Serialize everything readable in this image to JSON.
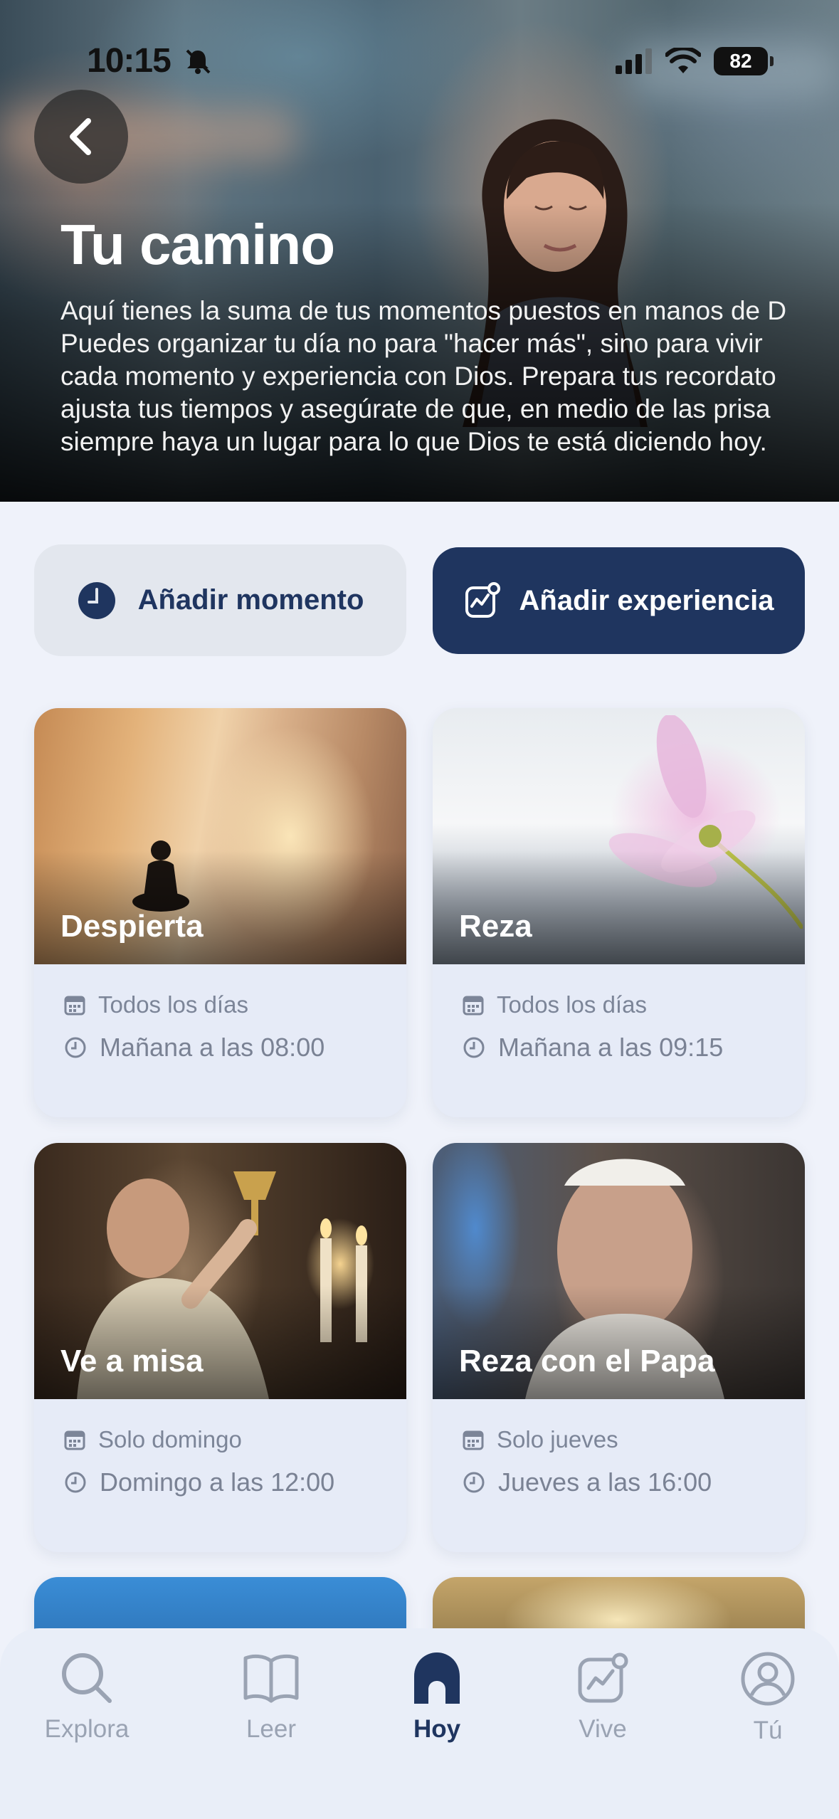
{
  "status_bar": {
    "time": "10:15",
    "battery": "82"
  },
  "hero": {
    "title": "Tu camino",
    "description_lines": [
      "Aquí tienes la suma de tus momentos puestos en manos de D",
      "Puedes organizar tu día no para \"hacer más\", sino para vivir",
      "cada momento y experiencia con Dios. Prepara tus recordato",
      "ajusta tus tiempos y asegúrate de que, en medio de las prisa",
      "siempre haya un lugar para lo que Dios te está diciendo hoy."
    ]
  },
  "actions": {
    "add_moment": "Añadir momento",
    "add_experience": "Añadir experiencia"
  },
  "cards": [
    {
      "title": "Despierta",
      "frequency": "Todos los días",
      "time": "Mañana a las 08:00"
    },
    {
      "title": "Reza",
      "frequency": "Todos los días",
      "time": "Mañana a las 09:15"
    },
    {
      "title": "Ve a misa",
      "frequency": "Solo domingo",
      "time": "Domingo a las 12:00"
    },
    {
      "title": "Reza con el Papa",
      "frequency": "Solo jueves",
      "time": "Jueves a las 16:00"
    }
  ],
  "tabs": [
    {
      "label": "Explora",
      "icon": "search-icon"
    },
    {
      "label": "Leer",
      "icon": "book-icon"
    },
    {
      "label": "Hoy",
      "icon": "home-icon",
      "active": true
    },
    {
      "label": "Vive",
      "icon": "activity-icon"
    },
    {
      "label": "Tú",
      "icon": "profile-icon"
    }
  ],
  "colors": {
    "primary": "#1f355f",
    "background": "#eff2fa",
    "card": "#e6ebf7",
    "inactive_tab": "#9aa3b3"
  }
}
